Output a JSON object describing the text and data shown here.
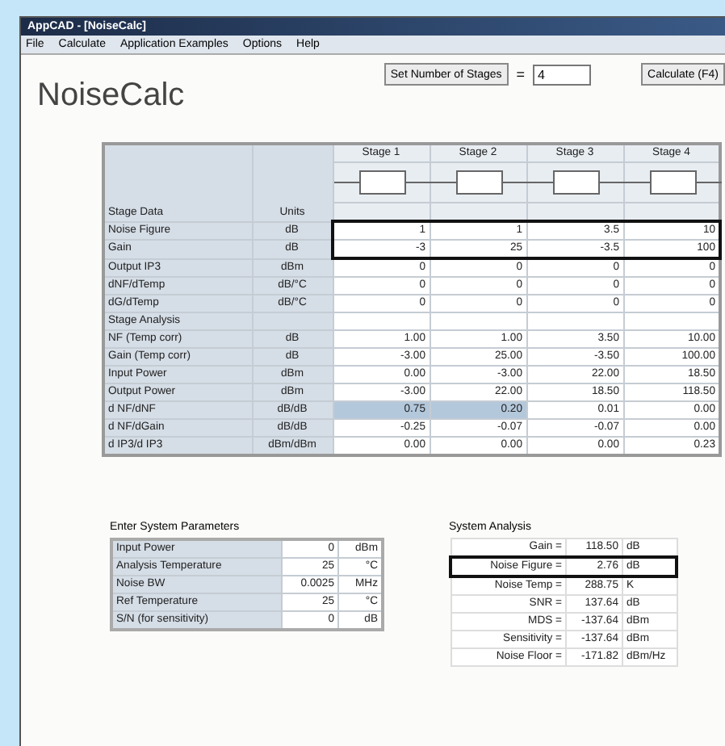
{
  "window": {
    "title": "AppCAD - [NoiseCalc]"
  },
  "menu": [
    "File",
    "Calculate",
    "Application Examples",
    "Options",
    "Help"
  ],
  "heading": "NoiseCalc",
  "toolbar": {
    "set_stages_button": "Set Number of Stages",
    "equals": "=",
    "stages_value": "4",
    "calculate_button": "Calculate (F4)"
  },
  "stage_table": {
    "stages": [
      "Stage 1",
      "Stage 2",
      "Stage 3",
      "Stage 4"
    ],
    "stage_data_title": "Stage Data",
    "units_title": "Units",
    "stage_data_rows": [
      {
        "label": "Noise Figure",
        "unit": "dB",
        "values": [
          "1",
          "1",
          "3.5",
          "10"
        ],
        "boxed": true
      },
      {
        "label": "Gain",
        "unit": "dB",
        "values": [
          "-3",
          "25",
          "-3.5",
          "100"
        ],
        "boxed": true
      },
      {
        "label": "Output IP3",
        "unit": "dBm",
        "values": [
          "0",
          "0",
          "0",
          "0"
        ],
        "boxed": false
      },
      {
        "label": "dNF/dTemp",
        "unit": "dB/°C",
        "values": [
          "0",
          "0",
          "0",
          "0"
        ],
        "boxed": false
      },
      {
        "label": "dG/dTemp",
        "unit": "dB/°C",
        "values": [
          "0",
          "0",
          "0",
          "0"
        ],
        "boxed": false
      }
    ],
    "analysis_title": "Stage Analysis",
    "analysis_rows": [
      {
        "label": "NF (Temp corr)",
        "unit": "dB",
        "cells": [
          {
            "text": "1.00",
            "highlighted": false
          },
          {
            "text": "1.00",
            "highlighted": false
          },
          {
            "text": "3.50",
            "highlighted": false
          },
          {
            "text": "10.00",
            "highlighted": false
          }
        ]
      },
      {
        "label": "Gain (Temp corr)",
        "unit": "dB",
        "cells": [
          {
            "text": "-3.00",
            "highlighted": false
          },
          {
            "text": "25.00",
            "highlighted": false
          },
          {
            "text": "-3.50",
            "highlighted": false
          },
          {
            "text": "100.00",
            "highlighted": false
          }
        ]
      },
      {
        "label": "Input Power",
        "unit": "dBm",
        "cells": [
          {
            "text": "0.00",
            "highlighted": false
          },
          {
            "text": "-3.00",
            "highlighted": false
          },
          {
            "text": "22.00",
            "highlighted": false
          },
          {
            "text": "18.50",
            "highlighted": false
          }
        ]
      },
      {
        "label": "Output Power",
        "unit": "dBm",
        "cells": [
          {
            "text": "-3.00",
            "highlighted": false
          },
          {
            "text": "22.00",
            "highlighted": false
          },
          {
            "text": "18.50",
            "highlighted": false
          },
          {
            "text": "118.50",
            "highlighted": false
          }
        ]
      },
      {
        "label": "d NF/dNF",
        "unit": "dB/dB",
        "cells": [
          {
            "text": "0.75",
            "highlighted": true
          },
          {
            "text": "0.20",
            "highlighted": true
          },
          {
            "text": "0.01",
            "highlighted": false
          },
          {
            "text": "0.00",
            "highlighted": false
          }
        ]
      },
      {
        "label": "d NF/dGain",
        "unit": "dB/dB",
        "cells": [
          {
            "text": "-0.25",
            "highlighted": false
          },
          {
            "text": "-0.07",
            "highlighted": false
          },
          {
            "text": "-0.07",
            "highlighted": false
          },
          {
            "text": "0.00",
            "highlighted": false
          }
        ]
      },
      {
        "label": "d IP3/d IP3",
        "unit": "dBm/dBm",
        "cells": [
          {
            "text": "0.00",
            "highlighted": false
          },
          {
            "text": "0.00",
            "highlighted": false
          },
          {
            "text": "0.00",
            "highlighted": false
          },
          {
            "text": "0.23",
            "highlighted": false
          }
        ]
      }
    ]
  },
  "system_parameters": {
    "title": "Enter System Parameters",
    "rows": [
      {
        "label": "Input Power",
        "value": "0",
        "unit": "dBm"
      },
      {
        "label": "Analysis Temperature",
        "value": "25",
        "unit": "°C"
      },
      {
        "label": "Noise BW",
        "value": "0.0025",
        "unit": "MHz"
      },
      {
        "label": "Ref Temperature",
        "value": "25",
        "unit": "°C"
      },
      {
        "label": "S/N (for sensitivity)",
        "value": "0",
        "unit": "dB"
      }
    ]
  },
  "system_analysis": {
    "title": "System Analysis",
    "rows": [
      {
        "label": "Gain =",
        "value": "118.50",
        "unit": "dB",
        "boxed": false
      },
      {
        "label": "Noise Figure =",
        "value": "2.76",
        "unit": "dB",
        "boxed": true
      },
      {
        "label": "Noise Temp =",
        "value": "288.75",
        "unit": "K",
        "boxed": false
      },
      {
        "label": "SNR =",
        "value": "137.64",
        "unit": "dB",
        "boxed": false
      },
      {
        "label": "MDS =",
        "value": "-137.64",
        "unit": "dBm",
        "boxed": false
      },
      {
        "label": "Sensitivity =",
        "value": "-137.64",
        "unit": "dBm",
        "boxed": false
      },
      {
        "label": "Noise Floor =",
        "value": "-171.82",
        "unit": "dBm/Hz",
        "boxed": false
      }
    ]
  }
}
